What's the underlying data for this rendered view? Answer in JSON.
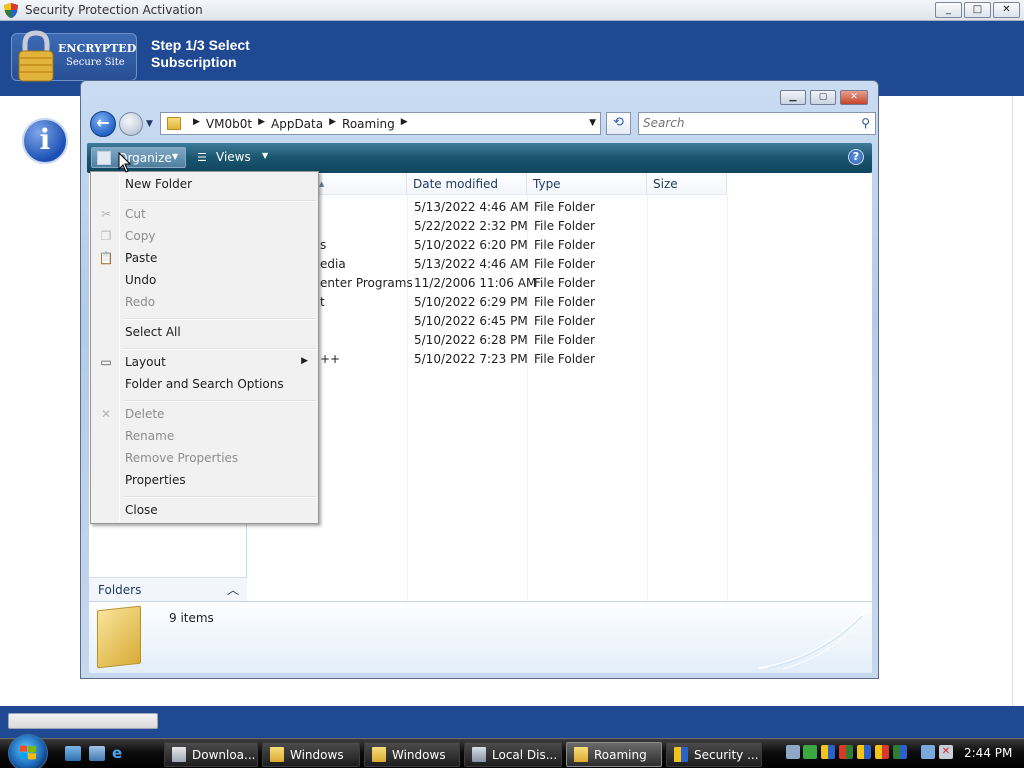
{
  "window": {
    "title": "Security Protection Activation",
    "min": "_",
    "max": "□",
    "close": "✕"
  },
  "banner": {
    "badge_line1": "ENCRYPTED",
    "badge_line2": "Secure Site",
    "step_text": "Step 1/3 Select Subscription",
    "bg_color": "#1f4a93"
  },
  "info_icon_glyph": "i",
  "explorer": {
    "breadcrumbs": [
      "VM0b0t",
      "AppData",
      "Roaming"
    ],
    "search_placeholder": "Search",
    "toolbar": {
      "organize": "Organize",
      "views": "Views",
      "help": "?"
    },
    "columns": [
      "Date modified",
      "Type",
      "Size"
    ],
    "rows": [
      {
        "name": "",
        "date": "5/13/2022 4:46 AM",
        "type": "File Folder"
      },
      {
        "name": "",
        "date": "5/22/2022 2:32 PM",
        "type": "File Folder"
      },
      {
        "name": "s",
        "date": "5/10/2022 6:20 PM",
        "type": "File Folder"
      },
      {
        "name": "edia",
        "date": "5/13/2022 4:46 AM",
        "type": "File Folder"
      },
      {
        "name": "enter Programs",
        "date": "11/2/2006 11:06 AM",
        "type": "File Folder"
      },
      {
        "name": "t",
        "date": "5/10/2022 6:29 PM",
        "type": "File Folder"
      },
      {
        "name": "",
        "date": "5/10/2022 6:45 PM",
        "type": "File Folder"
      },
      {
        "name": "",
        "date": "5/10/2022 6:28 PM",
        "type": "File Folder"
      },
      {
        "name": "++",
        "date": "5/10/2022 7:23 PM",
        "type": "File Folder"
      }
    ],
    "folders_label": "Folders",
    "item_count": "9 items"
  },
  "menu": {
    "new_folder": "New Folder",
    "cut": "Cut",
    "copy": "Copy",
    "paste": "Paste",
    "undo": "Undo",
    "redo": "Redo",
    "select_all": "Select All",
    "layout": "Layout",
    "folder_options": "Folder and Search Options",
    "delete": "Delete",
    "rename": "Rename",
    "remove_properties": "Remove Properties",
    "properties": "Properties",
    "close": "Close"
  },
  "taskbar": {
    "buttons": [
      {
        "label": "Downloa...",
        "icon": "downloads-icon"
      },
      {
        "label": "Windows",
        "icon": "folder-icon"
      },
      {
        "label": "Windows",
        "icon": "folder-icon"
      },
      {
        "label": "Local Dis...",
        "icon": "drive-icon"
      },
      {
        "label": "Roaming",
        "icon": "folder-icon"
      },
      {
        "label": "Security ...",
        "icon": "shield-icon"
      }
    ],
    "active": "Roaming",
    "clock": "2:44 PM"
  }
}
